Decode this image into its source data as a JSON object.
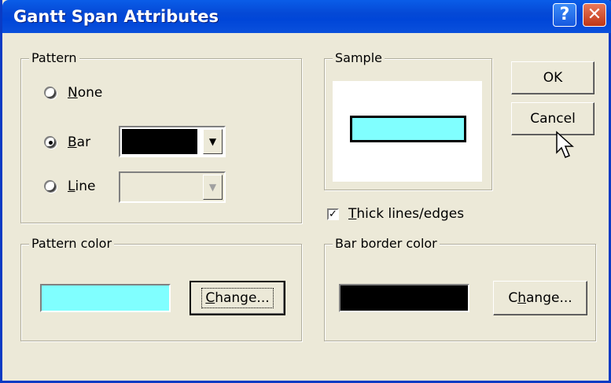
{
  "window": {
    "title": "Gantt Span Attributes",
    "help_glyph": "?",
    "close_glyph": "✕"
  },
  "pattern": {
    "legend": "Pattern",
    "none": {
      "accel": "N",
      "rest": "one"
    },
    "bar": {
      "accel": "B",
      "rest": "ar",
      "color": "#000000"
    },
    "line": {
      "accel": "L",
      "rest": "ine"
    },
    "selected": "bar"
  },
  "sample": {
    "legend": "Sample",
    "fill": "#80ffff",
    "border": "#000000"
  },
  "buttons": {
    "ok": "OK",
    "cancel": "Cancel"
  },
  "thick": {
    "checked": true,
    "accel": "T",
    "rest": "hick lines/edges"
  },
  "pattern_color": {
    "legend": "Pattern color",
    "color": "#80ffff",
    "change_accel": "C",
    "change_rest": "hange..."
  },
  "border_color": {
    "legend": "Bar border color",
    "color": "#000000",
    "change_pre": "C",
    "change_accel": "h",
    "change_rest": "ange..."
  }
}
